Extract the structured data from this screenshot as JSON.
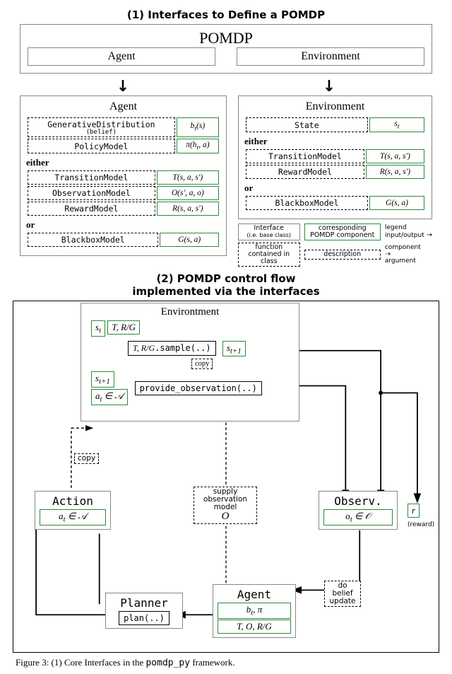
{
  "section1": {
    "title": "(1) Interfaces to Define a POMDP",
    "outerTitle": "POMDP",
    "agentLabel": "Agent",
    "envLabel": "Environment",
    "agentPanelTitle": "Agent",
    "envPanelTitle": "Environment",
    "agentRows": [
      {
        "if": "GenerativeDistribution",
        "sub": "(belief)",
        "math": "b_t(s)"
      },
      {
        "if": "PolicyModel",
        "math": "π(h_t, a)"
      }
    ],
    "either": "either",
    "agentEither": [
      {
        "if": "TransitionModel",
        "math": "T(s, a, s′)"
      },
      {
        "if": "ObservationModel",
        "math": "O(s′, a, o)"
      },
      {
        "if": "RewardModel",
        "math": "R(s, a, s′)"
      }
    ],
    "or": "or",
    "agentOr": [
      {
        "if": "BlackboxModel",
        "math": "G(s, a)"
      }
    ],
    "envRows": [
      {
        "if": "State",
        "math": "s_t"
      }
    ],
    "envEither": [
      {
        "if": "TransitionModel",
        "math": "T(s, a, s′)"
      },
      {
        "if": "RewardModel",
        "math": "R(s, a, s′)"
      }
    ],
    "envOr": [
      {
        "if": "BlackboxModel",
        "math": "G(s, a)"
      }
    ],
    "legend": {
      "title": "legend",
      "interface": "Interface",
      "interfaceSub": "(i.e. base class)",
      "component": "corresponding POMDP component",
      "ioLabel": "input/output",
      "funcBox": "function contained in class",
      "desc": "description",
      "compArg1": "component",
      "compArg2": "argument"
    }
  },
  "section2": {
    "title1": "(2) POMDP control flow",
    "title2": "implemented via the interfaces",
    "env": {
      "title": "Environtment",
      "st": "s_t",
      "trg": "T, R/G",
      "sample": "T, R/G.sample(..)",
      "stplus": "s_{t+1}",
      "copy": "copy",
      "stplus2": "s_{t+1}",
      "aInA": "a_t ∈ 𝒜",
      "provide": "provide_observation(..)"
    },
    "copyOutside": "copy",
    "action": {
      "title": "Action",
      "val": "a_t ∈ 𝒜"
    },
    "supply": "supply observation model",
    "supplyO": "O",
    "observ": {
      "title": "Observ.",
      "val": "o_t ∈ 𝒪"
    },
    "reward": {
      "chip": "r",
      "label": "(reward)"
    },
    "planner": {
      "title": "Planner",
      "plan": "plan(..)"
    },
    "agent": {
      "title": "Agent",
      "top": "b_t, π",
      "bottom": "T, O, R/G"
    },
    "belief": "do belief update"
  },
  "caption": "Figure 3: (1) Core Interfaces in the"
}
